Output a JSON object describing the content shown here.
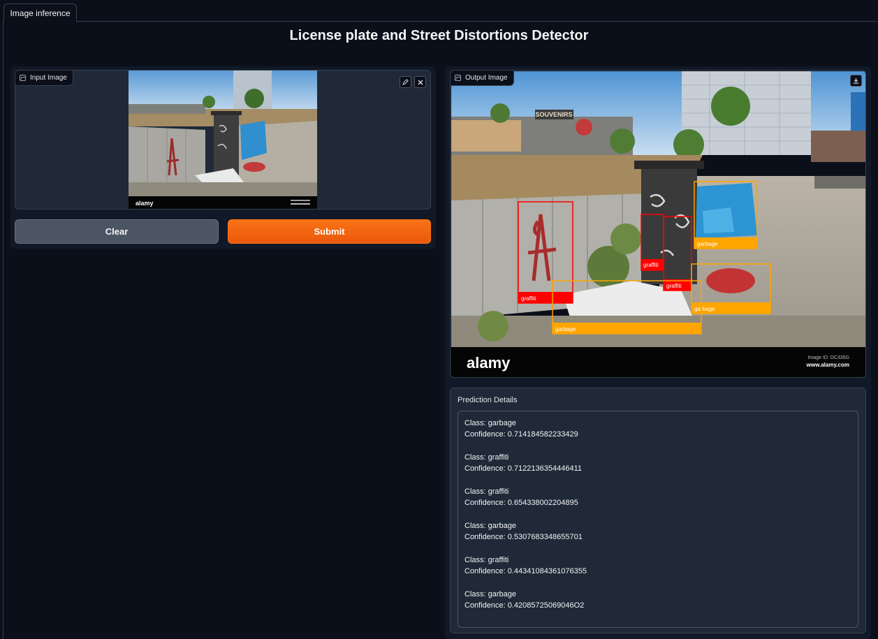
{
  "tabs": [
    {
      "label": "Image inference"
    }
  ],
  "page": {
    "title": "License plate and Street Distortions Detector"
  },
  "input": {
    "label": "Input Image",
    "watermark": "alamy",
    "edit_icon": "pencil-icon",
    "clear_icon": "close-icon"
  },
  "buttons": {
    "clear": "Clear",
    "submit": "Submit"
  },
  "output": {
    "label": "Output Image",
    "download_icon": "download-icon",
    "watermark": "alamy",
    "image_id": "Image ID: DC335G",
    "site": "www.alamy.com",
    "sign_text": "SOUVENIRS",
    "detections": [
      {
        "class": "graffiti",
        "tag": "graffiti",
        "color": "#ff0000"
      },
      {
        "class": "graffiti",
        "tag": "graffiti",
        "color": "#ff0000"
      },
      {
        "class": "graffiti",
        "tag": "graffiti",
        "color": "#ff0000"
      },
      {
        "class": "garbage",
        "tag": "garbage",
        "color": "#ffa500"
      },
      {
        "class": "garbage",
        "tag": "garbage",
        "color": "#ffa500"
      },
      {
        "class": "garbage",
        "tag": "garbage",
        "color": "#ffa500"
      }
    ]
  },
  "predictions": {
    "label": "Prediction Details",
    "items": [
      {
        "class_line": "Class: garbage",
        "conf_line": "Confidence: 0.714184582233429"
      },
      {
        "class_line": "Class: graffiti",
        "conf_line": "Confidence: 0.7122136354446411"
      },
      {
        "class_line": "Class: graffiti",
        "conf_line": "Confidence: 0.654338002204895"
      },
      {
        "class_line": "Class: garbage",
        "conf_line": "Confidence: 0.5307683348655701"
      },
      {
        "class_line": "Class: graffiti",
        "conf_line": "Confidence: 0.44341084361076355"
      },
      {
        "class_line": "Class: garbage",
        "conf_line": "Confidence: 0.42085725069046O2"
      }
    ]
  },
  "colors": {
    "background": "#0b0f19",
    "panel": "#111827",
    "block": "#1f2937",
    "accent": "#f97316",
    "graffiti_box": "#ff0000",
    "garbage_box": "#ffa500"
  }
}
